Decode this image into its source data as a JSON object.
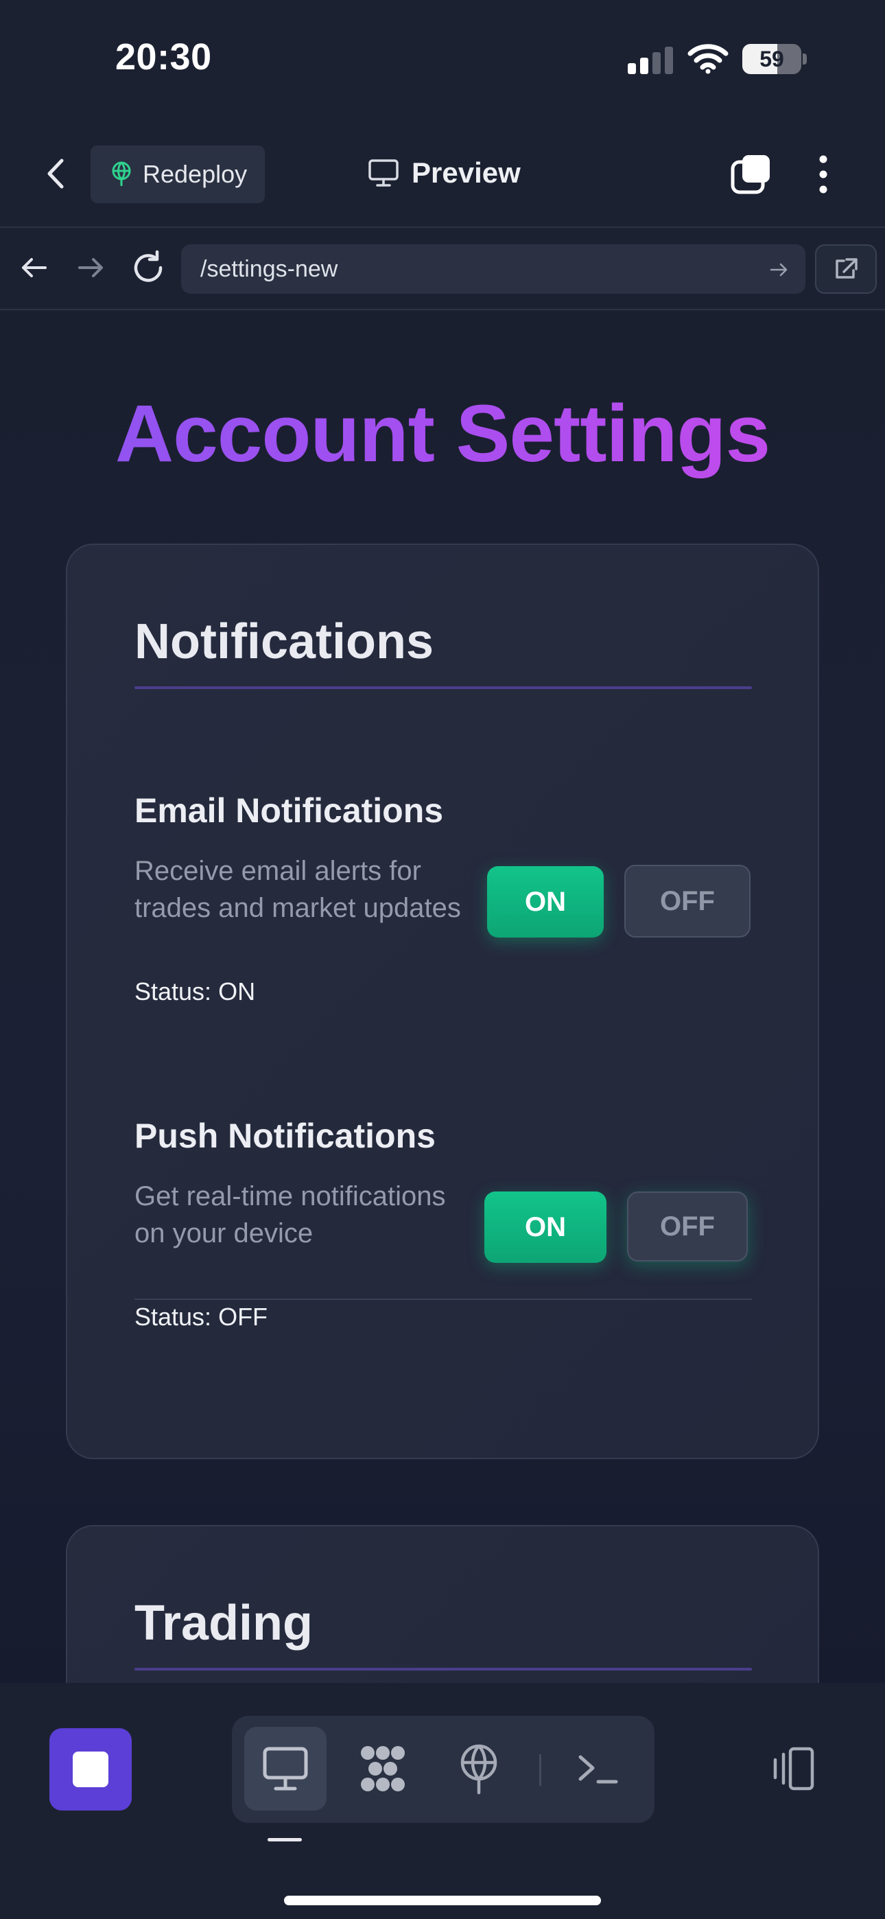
{
  "status_bar": {
    "time": "20:30",
    "battery_level": "59",
    "signal_bars": 2,
    "signal_bars_total": 4
  },
  "app_bar": {
    "back_icon": "chevron-left-icon",
    "redeploy_label": "Redeploy",
    "redeploy_icon": "globe-tree-icon",
    "title": "Preview",
    "title_icon": "monitor-icon",
    "tabs_icon": "tabs-icon",
    "more_icon": "more-vertical-icon"
  },
  "url_bar": {
    "path": "/settings-new",
    "back_icon": "arrow-left-icon",
    "forward_icon": "arrow-right-icon",
    "reload_icon": "reload-icon",
    "go_icon": "arrow-right-icon",
    "external_icon": "external-link-icon"
  },
  "page": {
    "title": "Account Settings",
    "sections": [
      {
        "heading": "Notifications",
        "settings": [
          {
            "title": "Email Notifications",
            "description": "Receive email alerts for trades and market updates",
            "status": "Status: ON",
            "on_label": "ON",
            "off_label": "OFF"
          },
          {
            "title": "Push Notifications",
            "description": "Get real-time notifications on your device",
            "status": "Status: OFF",
            "on_label": "ON",
            "off_label": "OFF"
          }
        ]
      },
      {
        "heading": "Trading"
      }
    ]
  },
  "toolbar": {
    "stop_icon": "stop-icon",
    "items": [
      "monitor-icon",
      "nodes-icon",
      "globe-tree-icon",
      "terminal-icon"
    ],
    "active_index": 0,
    "device_icon": "device-toggle-icon"
  },
  "colors": {
    "accent_purple": "#5b3fd6",
    "title_gradient_start": "#8a55f0",
    "title_gradient_end": "#c94bea",
    "on_green": "#12c48a",
    "background": "#1c2131"
  }
}
